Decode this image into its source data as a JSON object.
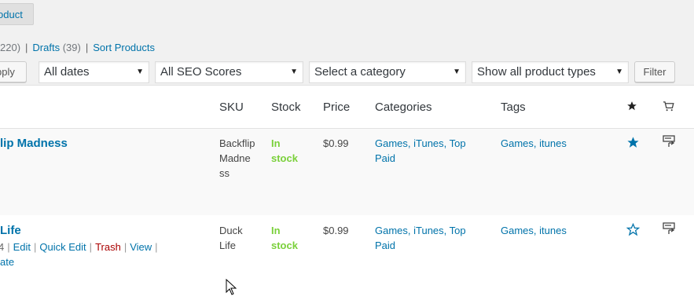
{
  "top_button": {
    "label": "oduct"
  },
  "status_links": {
    "all_count": "220)",
    "drafts_label": "Drafts",
    "drafts_count": "(39)",
    "sort_label": "Sort Products",
    "separator": "|"
  },
  "tablenav": {
    "apply_label": "pply",
    "dates_selected": "All dates",
    "seo_selected": "All SEO Scores",
    "category_selected": "Select a category",
    "product_type_selected": "Show all product types",
    "filter_label": "Filter"
  },
  "columns": {
    "sku": "SKU",
    "stock": "Stock",
    "price": "Price",
    "categories": "Categories",
    "tags": "Tags",
    "featured_icon": "star-filled-icon",
    "type_icon": "cart-icon"
  },
  "rows": [
    {
      "name": "lip Madness",
      "sku_lines": [
        "Backflip",
        "Madne",
        "ss"
      ],
      "stock_lines": [
        "In",
        "stock"
      ],
      "price": "$0.99",
      "categories_lines": [
        "Games, iTunes, Top",
        "Paid"
      ],
      "tags": "Games, itunes",
      "featured": true,
      "featured_icon": "star-filled-icon",
      "type_icon": "external-product-icon"
    },
    {
      "name": "Life",
      "sku_lines": [
        "Duck",
        "Life"
      ],
      "stock_lines": [
        "In",
        "stock"
      ],
      "price": "$0.99",
      "categories_lines": [
        "Games, iTunes, Top",
        "Paid"
      ],
      "tags": "Games, itunes",
      "featured": false,
      "featured_icon": "star-outline-icon",
      "type_icon": "external-product-icon",
      "actions": {
        "id_fragment": "4",
        "edit": "Edit",
        "quick_edit": "Quick Edit",
        "trash": "Trash",
        "view": "View",
        "duplicate_fragment": "ate",
        "separator": "|"
      }
    }
  ],
  "colors": {
    "link": "#0073aa",
    "in_stock": "#7ad03a",
    "trash": "#aa0000",
    "star": "#0073aa"
  }
}
